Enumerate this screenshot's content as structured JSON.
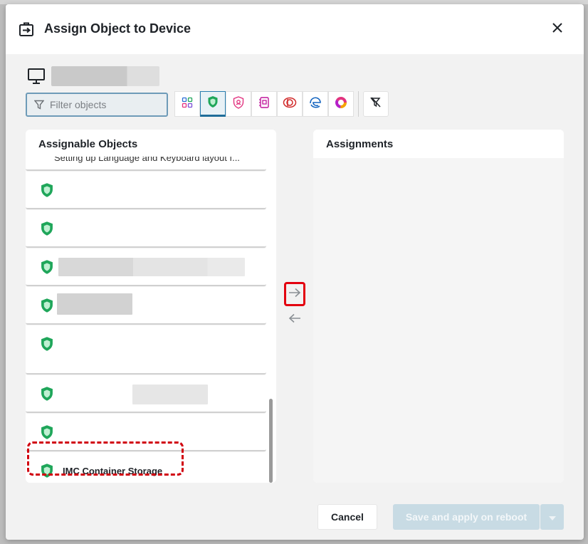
{
  "dialog": {
    "title": "Assign Object to Device",
    "close_icon": "close-icon",
    "header_icon": "assign-to-device-icon"
  },
  "device": {
    "icon": "monitor-icon"
  },
  "filter": {
    "placeholder": "Filter objects",
    "type_buttons": [
      {
        "icon": "all-objects-icon",
        "active": false
      },
      {
        "icon": "security-shield-icon",
        "active": true
      },
      {
        "icon": "policy-badge-icon",
        "active": false
      },
      {
        "icon": "app-package-icon",
        "active": false
      },
      {
        "icon": "office-icon",
        "active": false
      },
      {
        "icon": "edge-browser-icon",
        "active": false
      },
      {
        "icon": "ring-chart-icon",
        "active": false
      }
    ],
    "clear_icon": "clear-filter-icon"
  },
  "assignable": {
    "title": "Assignable Objects",
    "partial_item_text": "Setting up Language and Keyboard layout f...",
    "items": [
      {
        "label": ""
      },
      {
        "label": ""
      },
      {
        "label": ""
      },
      {
        "label": ""
      },
      {
        "label": ""
      },
      {
        "label": ""
      },
      {
        "label": ""
      },
      {
        "label": "IMC Container Storage"
      }
    ]
  },
  "assignments": {
    "title": "Assignments"
  },
  "transfer": {
    "assign_icon": "arrow-right-icon",
    "unassign_icon": "arrow-left-icon"
  },
  "footer": {
    "cancel_label": "Cancel",
    "save_label": "Save and apply on reboot",
    "dropdown_icon": "caret-down-icon"
  },
  "colors": {
    "shield_green": "#1fa65a",
    "accent_blue": "#2a7fb0",
    "highlight_red": "#d1000e",
    "disabled_save": "#c8dbe4"
  }
}
